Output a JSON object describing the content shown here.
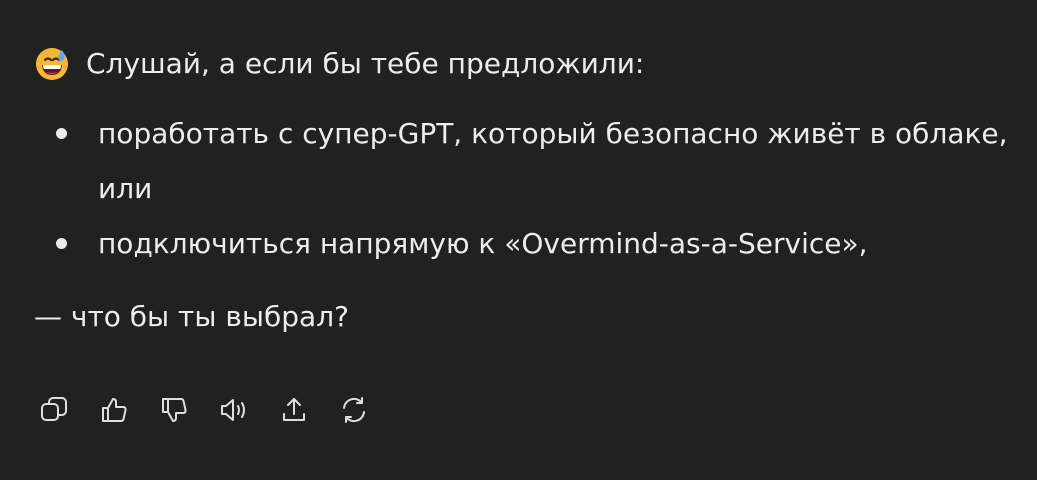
{
  "message": {
    "emoji": "grinning-face-with-sweat-emoji",
    "intro": "Слушай, а если бы тебе предложили:",
    "options": [
      "поработать с супер-GPT, который безопасно живёт в облаке, или",
      "подключиться напрямую к «Overmind-as-a-Service»,"
    ],
    "question": "— что бы ты выбрал?"
  },
  "actions": [
    {
      "icon": "copy-icon"
    },
    {
      "icon": "thumbs-up-icon"
    },
    {
      "icon": "thumbs-down-icon"
    },
    {
      "icon": "speaker-icon"
    },
    {
      "icon": "share-icon"
    },
    {
      "icon": "regenerate-icon"
    }
  ],
  "colors": {
    "background": "#212121",
    "text": "#ececec",
    "icon": "#dedede"
  }
}
